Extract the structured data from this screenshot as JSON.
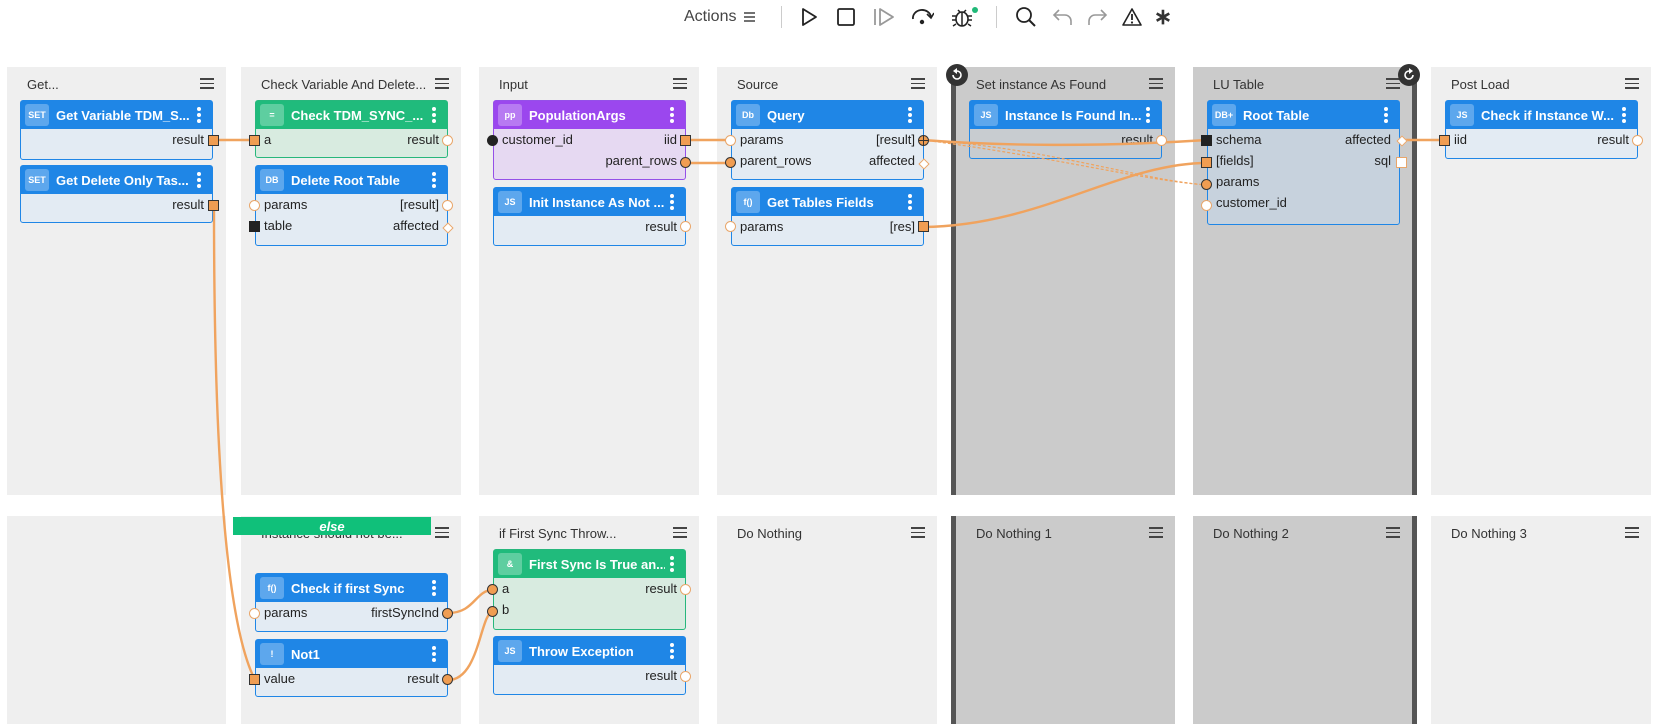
{
  "toolbar": {
    "actions_label": "Actions",
    "icons": [
      "play-icon",
      "stop-icon",
      "step-icon",
      "step-over-icon",
      "debug-icon",
      "search-icon",
      "undo-icon",
      "redo-icon",
      "warning-icon",
      "asterisk-icon"
    ]
  },
  "stages_top": [
    {
      "title": "Get..."
    },
    {
      "title": "Check Variable And Delete..."
    },
    {
      "title": "Input"
    },
    {
      "title": "Source"
    },
    {
      "title": "Set instance As Found"
    },
    {
      "title": "LU Table"
    },
    {
      "title": "Post Load"
    }
  ],
  "stages_bottom": [
    {
      "title": "Instance should not be..."
    },
    {
      "title": "if First Sync Throw..."
    },
    {
      "title": "Do Nothing"
    },
    {
      "title": "Do Nothing 1"
    },
    {
      "title": "Do Nothing 2"
    },
    {
      "title": "Do Nothing 3"
    }
  ],
  "else_label": "else",
  "actors": {
    "get_var": {
      "badge": "SET",
      "name": "Get Variable TDM_S...",
      "out": "result"
    },
    "get_delete": {
      "badge": "SET",
      "name": "Get Delete Only Tas...",
      "out": "result"
    },
    "check_sync": {
      "badge": "=",
      "name": "Check TDM_SYNC_...",
      "in": "a",
      "out": "result"
    },
    "delete_root": {
      "badge": "DB",
      "name": "Delete Root Table",
      "in1": "params",
      "out1": "[result]",
      "in2": "table",
      "out2": "affected"
    },
    "population": {
      "badge": "pp",
      "name": "PopulationArgs",
      "in1": "customer_id",
      "out1": "iid",
      "out2": "parent_rows"
    },
    "init_instance": {
      "badge": "JS",
      "name": "Init Instance As Not ...",
      "out": "result"
    },
    "query": {
      "badge": "Db",
      "name": "Query",
      "in1": "params",
      "out1": "[result]",
      "in2": "parent_rows",
      "out2": "affected"
    },
    "get_tables": {
      "badge": "f()",
      "name": "Get Tables Fields",
      "in": "params",
      "out": "[res]"
    },
    "instance_found": {
      "badge": "JS",
      "name": "Instance Is Found In...",
      "out": "result"
    },
    "root_table": {
      "badge": "DB+",
      "name": "Root Table",
      "in1": "schema",
      "out1": "affected",
      "in2": "[fields]",
      "out2": "sql",
      "in3": "params",
      "in4": "customer_id"
    },
    "check_instance": {
      "badge": "JS",
      "name": "Check if Instance W...",
      "in": "iid",
      "out": "result"
    },
    "check_first": {
      "badge": "f()",
      "name": "Check if first Sync",
      "in": "params",
      "out": "firstSyncInd"
    },
    "not1": {
      "badge": "!",
      "name": "Not1",
      "in": "value",
      "out": "result"
    },
    "first_sync_true": {
      "badge": "&",
      "name": "First Sync Is True an...",
      "in1": "a",
      "out": "result",
      "in2": "b"
    },
    "throw_exception": {
      "badge": "JS",
      "name": "Throw Exception",
      "out": "result"
    }
  },
  "colors": {
    "actor_blue": "#1f86e6",
    "actor_green": "#20bb7c",
    "actor_purple": "#9b47ee",
    "wire": "#f0a35e",
    "stage_light": "#efefef",
    "stage_dark": "#cbcbcb",
    "else_green": "#10c07a"
  }
}
